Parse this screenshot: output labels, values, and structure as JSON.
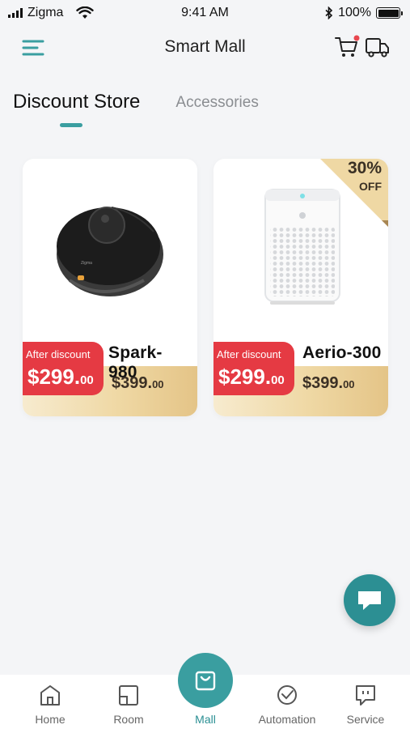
{
  "status_bar": {
    "carrier": "Zigma",
    "time": "9:41 AM",
    "battery": "100%"
  },
  "header": {
    "title": "Smart Mall",
    "icons": [
      "menu-icon",
      "cart-icon",
      "delivery-truck-icon"
    ],
    "cart_badge_color": "#e8474f"
  },
  "tabs": {
    "active": "Discount Store",
    "inactive": "Accessories",
    "accent_color": "#3a9ea0"
  },
  "products": [
    {
      "name": "Spark-980",
      "badge_label": "After discount",
      "discount_price_main": "$299.",
      "discount_price_cents": "00",
      "original_price_main": "$399.",
      "original_price_cents": "00",
      "image": "robot-vacuum-icon",
      "device_brand": "Zigma"
    },
    {
      "name": "Aerio-300",
      "badge_label": "After discount",
      "discount_price_main": "$299.",
      "discount_price_cents": "00",
      "original_price_main": "$399.",
      "original_price_cents": "00",
      "image": "air-purifier-icon",
      "corner_percent": "30%",
      "corner_off": "OFF"
    }
  ],
  "colors": {
    "badge_red": "#e53a43",
    "gold_band": "#efd8a4",
    "teal": "#3a9ea0"
  },
  "floating_button": {
    "icon": "chat-icon"
  },
  "bottom_nav": {
    "items": [
      {
        "label": "Home",
        "icon": "home-icon"
      },
      {
        "label": "Room",
        "icon": "room-icon"
      },
      {
        "label": "Mall",
        "icon": "shopping-bag-icon"
      },
      {
        "label": "Automation",
        "icon": "clock-icon"
      },
      {
        "label": "Service",
        "icon": "service-chat-icon"
      }
    ],
    "active": "Mall"
  }
}
